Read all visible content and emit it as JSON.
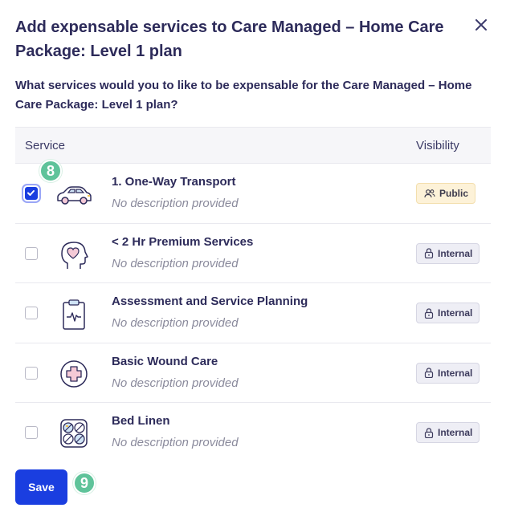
{
  "dialog": {
    "title": "Add expensable services to Care Managed – Home Care Package: Level 1 plan",
    "question": "What services would you to like to be expensable for the Care Managed – Home Care Package: Level 1 plan?"
  },
  "table": {
    "headers": {
      "service": "Service",
      "visibility": "Visibility"
    },
    "rows": [
      {
        "name": "1. One-Way Transport",
        "description": "No description provided",
        "visibility": "Public",
        "checked": true,
        "icon": "car-icon"
      },
      {
        "name": "< 2 Hr Premium Services",
        "description": "No description provided",
        "visibility": "Internal",
        "checked": false,
        "icon": "head-heart-icon"
      },
      {
        "name": "Assessment and Service Planning",
        "description": "No description provided",
        "visibility": "Internal",
        "checked": false,
        "icon": "clipboard-icon"
      },
      {
        "name": "Basic Wound Care",
        "description": "No description provided",
        "visibility": "Internal",
        "checked": false,
        "icon": "medical-cross-icon"
      },
      {
        "name": "Bed Linen",
        "description": "No description provided",
        "visibility": "Internal",
        "checked": false,
        "icon": "pills-icon"
      }
    ]
  },
  "steps": {
    "checkbox_step": "8",
    "save_step": "9"
  },
  "actions": {
    "save_label": "Save"
  },
  "colors": {
    "primary": "#1a3ee0",
    "step_badge": "#5fc39a",
    "public_badge_bg": "#fdf2d8",
    "internal_badge_bg": "#eeeef5"
  }
}
